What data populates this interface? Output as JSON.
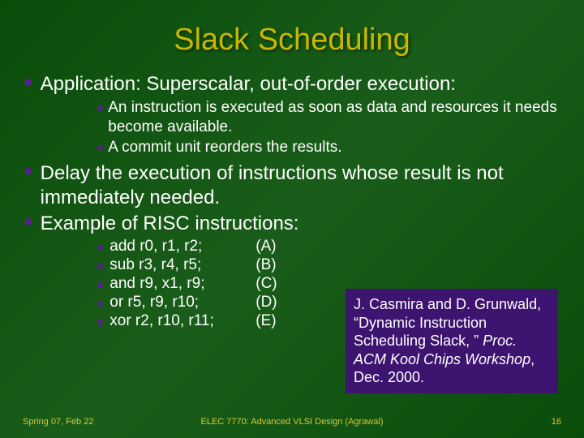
{
  "title": "Slack Scheduling",
  "bullets": {
    "b1": "Application: Superscalar, out-of-order execution:",
    "b1_sub1": "An instruction is executed as soon as data and resources it needs become available.",
    "b1_sub2": "A commit unit reorders the results.",
    "b2": "Delay the execution of instructions whose result is not immediately needed.",
    "b3": "Example of RISC instructions:"
  },
  "instructions": [
    {
      "text": "add  r0, r1, r2;",
      "label": "(A)"
    },
    {
      "text": "sub r3, r4, r5;",
      "label": "(B)"
    },
    {
      "text": "and r9, x1, r9;",
      "label": "(C)"
    },
    {
      "text": "or   r5, r9, r10;",
      "label": "(D)"
    },
    {
      "text": "xor r2, r10, r11;",
      "label": "(E)"
    }
  ],
  "citation": {
    "authors": "J. Casmira and D. Grunwald, “Dynamic Instruction Scheduling Slack, ” ",
    "venue": "Proc. ACM Kool Chips Workshop",
    "rest": ", Dec. 2000."
  },
  "footer": {
    "left": "Spring 07, Feb 22",
    "center": "ELEC 7770: Advanced VLSI Design (Agrawal)",
    "right": "16"
  }
}
